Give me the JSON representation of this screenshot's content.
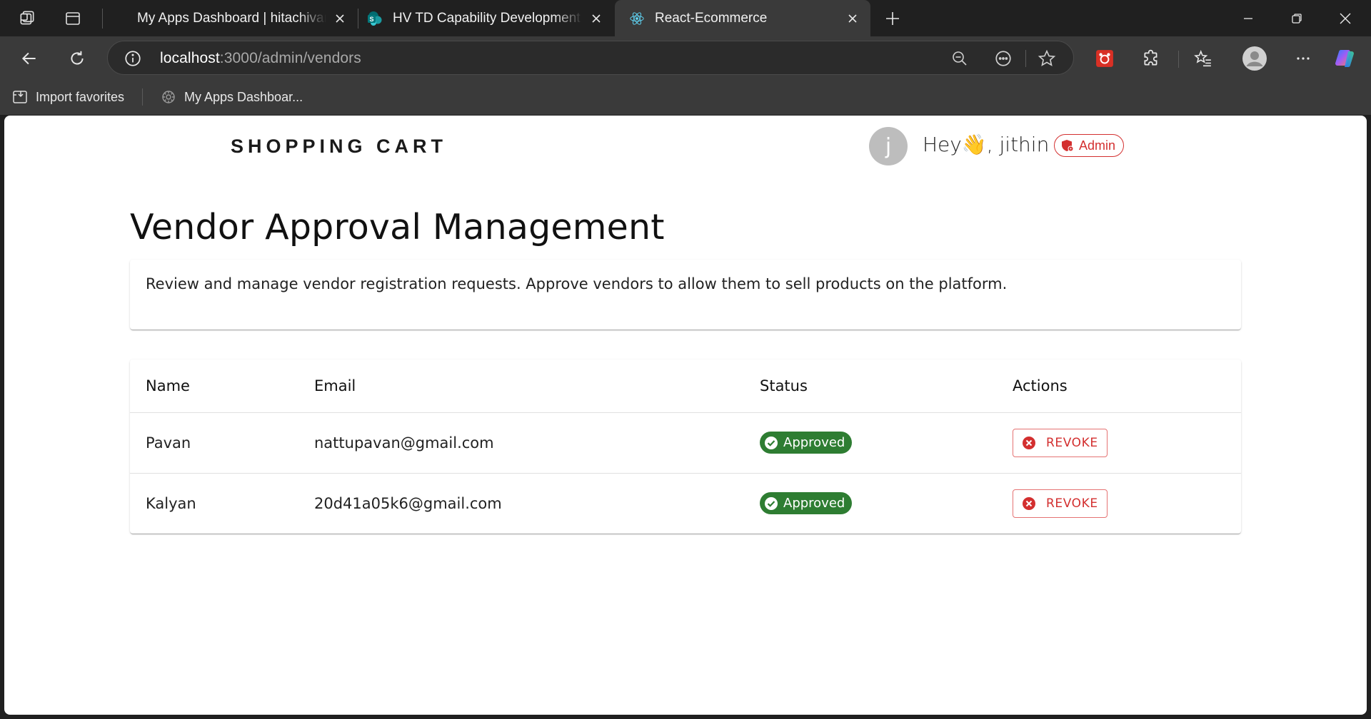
{
  "browser": {
    "tabs": [
      {
        "title": "My Apps Dashboard | hitachivantara",
        "active": false
      },
      {
        "title": "HV TD Capability Development (L",
        "active": false
      },
      {
        "title": "React-Ecommerce",
        "active": true
      }
    ],
    "address": {
      "host": "localhost",
      "path": ":3000/admin/vendors"
    },
    "favorites": [
      {
        "label": "Import favorites",
        "icon": "import-icon"
      },
      {
        "label": "My Apps Dashboar...",
        "icon": "apps-icon"
      }
    ]
  },
  "header": {
    "brand": "SHOPPING CART",
    "avatar_initial": "j",
    "greeting": "Hey👋, jithin",
    "role_label": "Admin"
  },
  "main": {
    "title": "Vendor Approval Management",
    "description": "Review and manage vendor registration requests. Approve vendors to allow them to sell products on the platform.",
    "table": {
      "columns": [
        "Name",
        "Email",
        "Status",
        "Actions"
      ],
      "rows": [
        {
          "name": "Pavan",
          "email": "nattupavan@gmail.com",
          "status": "Approved",
          "action": "REVOKE"
        },
        {
          "name": "Kalyan",
          "email": "20d41a05k6@gmail.com",
          "status": "Approved",
          "action": "REVOKE"
        }
      ]
    }
  },
  "colors": {
    "approved": "#2e7d32",
    "revoke": "#d32f2f",
    "admin": "#d32f2f"
  }
}
